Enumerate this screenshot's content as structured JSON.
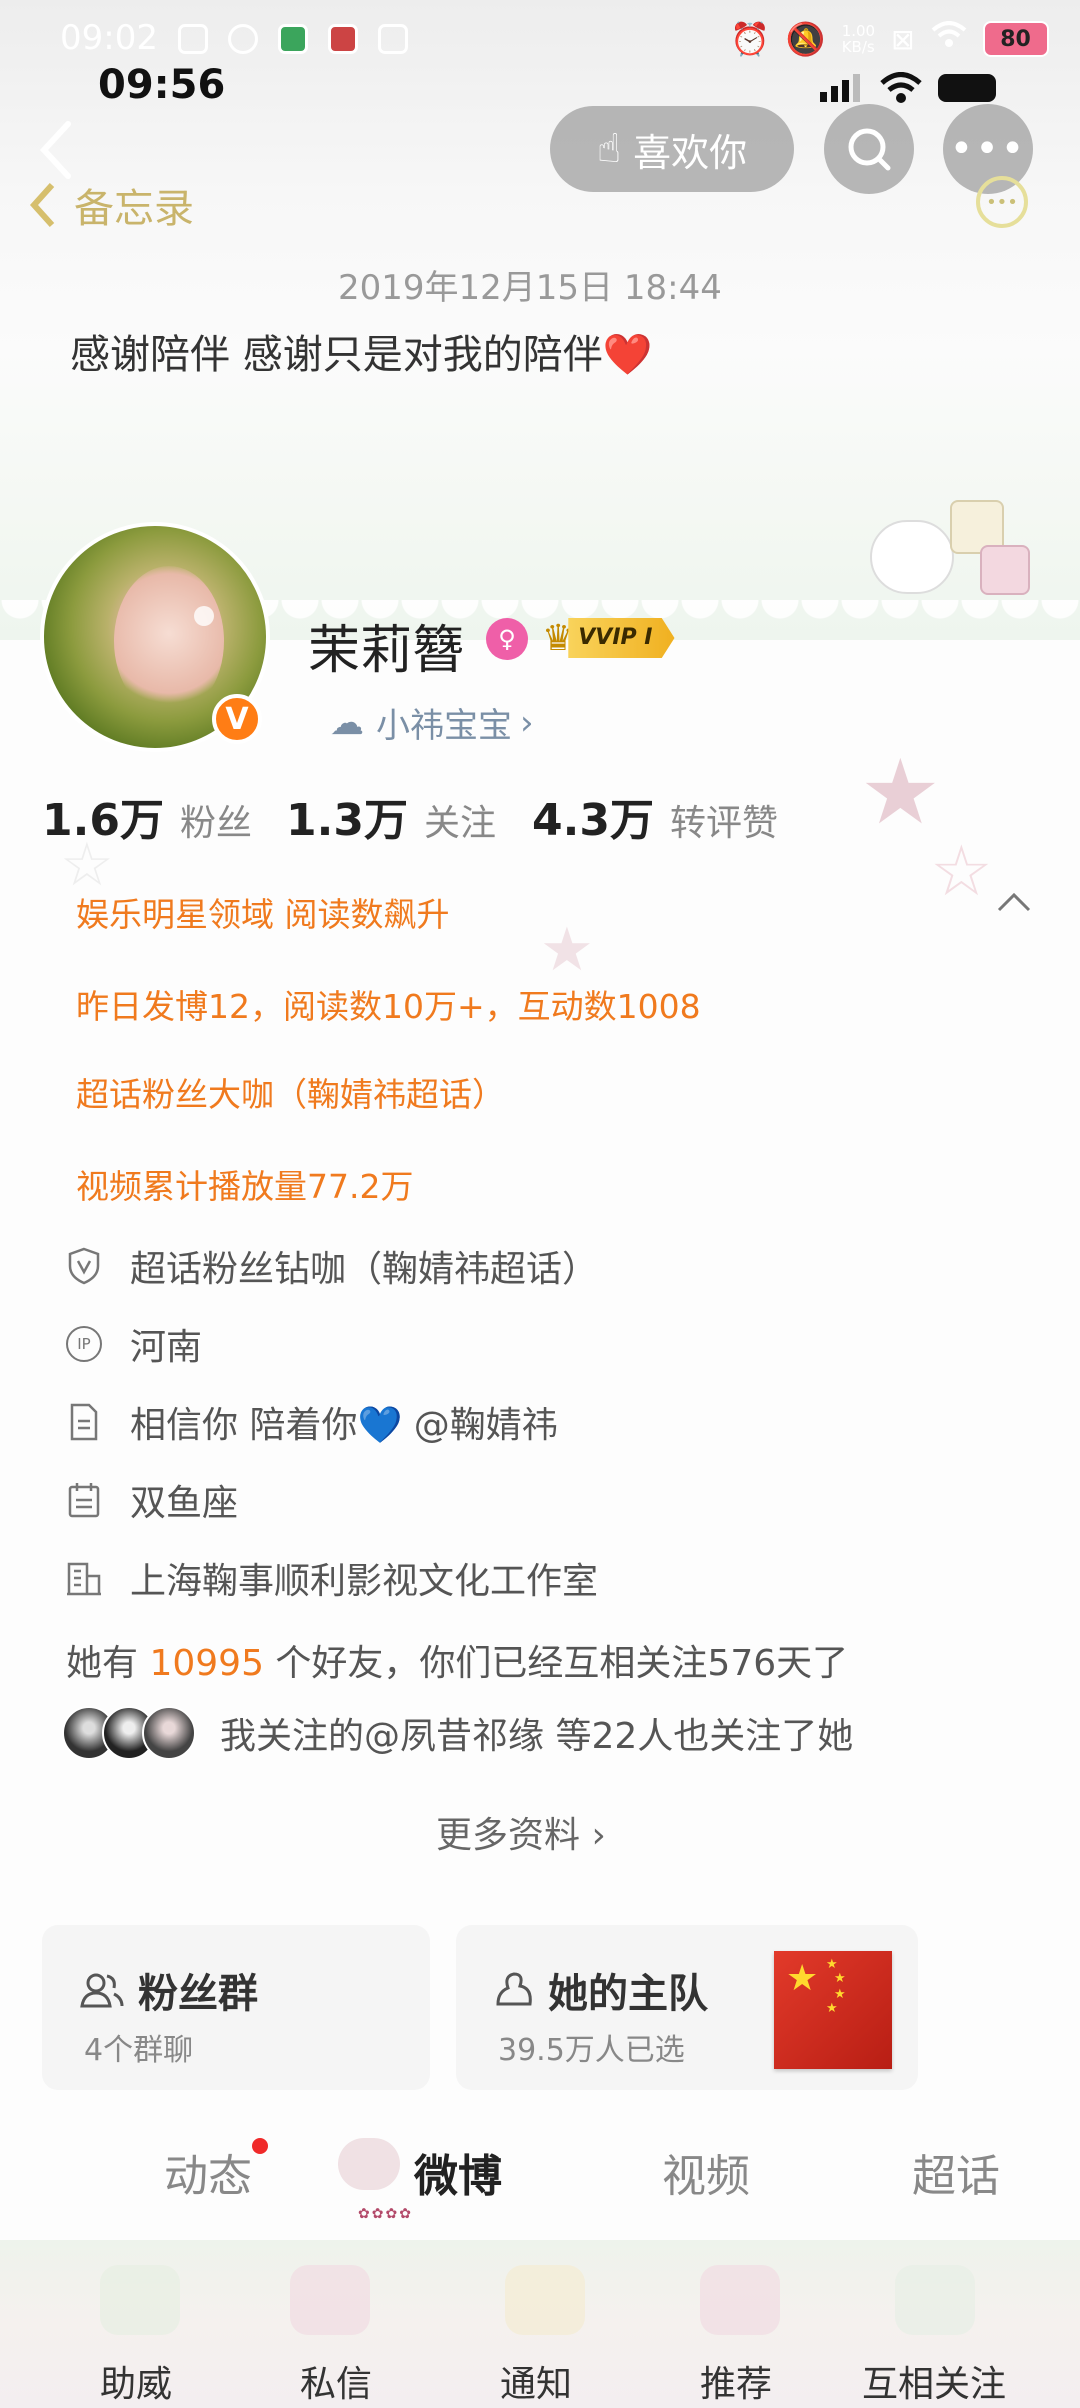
{
  "colors": {
    "accent_orange": "#f07a1e",
    "link_blue": "#7a8fa6",
    "vip_gold": "#f3c13b",
    "badge_orange": "#ff7d15",
    "notify_red": "#f02a2a"
  },
  "status_bar_outer": {
    "time": "09:02",
    "net_speed_value": "1.00",
    "net_speed_unit": "KB/s",
    "battery": "80"
  },
  "status_bar_inner": {
    "time": "09:56"
  },
  "nav": {
    "like_label": "喜欢你"
  },
  "memo": {
    "back_label": "备忘录",
    "date": "2019年12月15日 18:44",
    "text": "感谢陪伴 感谢只是对我的陪伴❤️"
  },
  "profile": {
    "name": "茉莉簪",
    "vip_label": "VVIP I",
    "verified_mark": "V",
    "tag": "小祎宝宝",
    "stats": [
      {
        "value": "1.6万",
        "label": "粉丝"
      },
      {
        "value": "1.3万",
        "label": "关注"
      },
      {
        "value": "4.3万",
        "label": "转评赞"
      }
    ]
  },
  "highlights": [
    "娱乐明星领域 阅读数飙升",
    "昨日发博12，阅读数10万+，互动数1008",
    "超话粉丝大咖（鞠婧祎超话）",
    "视频累计播放量77.2万"
  ],
  "info": {
    "badge": "超话粉丝钻咖（鞠婧祎超话）",
    "ip_icon_text": "IP",
    "ip": "河南",
    "bio": "相信你 陪着你💙 @鞠婧祎",
    "zodiac": "双鱼座",
    "company": "上海鞠事顺利影视文化工作室",
    "friends_prefix": "她有 ",
    "friends_count": "10995",
    "friends_suffix": " 个好友，你们已经互相关注576天了",
    "mutual": "我关注的@夙昔祁缘 等22人也关注了她",
    "more": "更多资料 ›"
  },
  "cards": {
    "fans_group": {
      "title": "粉丝群",
      "sub": "4个群聊"
    },
    "team": {
      "title": "她的主队",
      "sub": "39.5万人已选"
    }
  },
  "tabs": [
    "动态",
    "微博",
    "视频",
    "超话"
  ],
  "bottom_nav": [
    "助威",
    "私信",
    "通知",
    "推荐",
    "互相关注"
  ]
}
